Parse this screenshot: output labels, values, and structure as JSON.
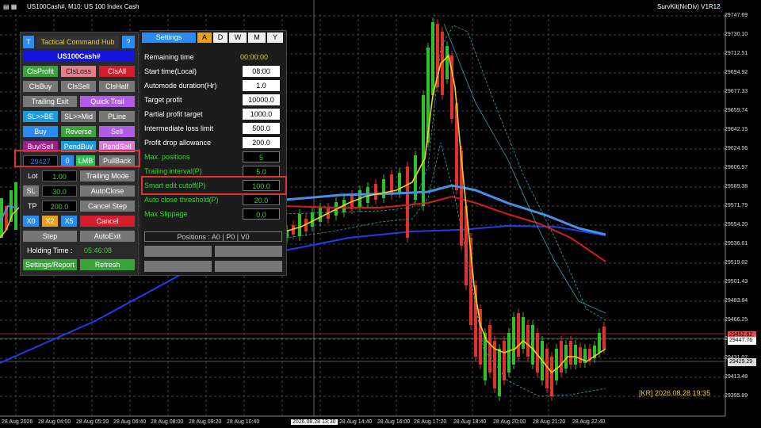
{
  "header": {
    "symbol_text": "US100Cash#, M10:  US 100 Index Cash",
    "indicator_text": "SurvKit(NoDiv) V1R12"
  },
  "price_axis": [
    "29747.69",
    "29730.10",
    "29712.51",
    "29694.92",
    "29677.33",
    "29659.74",
    "29642.15",
    "29624.56",
    "29606.97",
    "29589.38",
    "29571.79",
    "29554.20",
    "29536.61",
    "29519.02",
    "29501.43",
    "29483.84",
    "29466.25",
    "29448.66",
    "29431.07",
    "29413.48",
    "29395.89"
  ],
  "price_tags": [
    {
      "text": "29452.62",
      "color": "#e05050"
    },
    {
      "text": "29447.76",
      "color": "#ffffff"
    },
    {
      "text": "29429.29",
      "color": "#dddddd"
    }
  ],
  "time_axis": [
    "28 Aug 2026",
    "28 Aug 04:00",
    "28 Aug 05:20",
    "28 Aug 06:40",
    "28 Aug 08:00",
    "28 Aug 09:20",
    "28 Aug 10:40",
    "2026.08.28 13:30",
    "28 Aug 14:40",
    "28 Aug 16:00",
    "28 Aug 17:20",
    "28 Aug 18:40",
    "28 Aug 20:00",
    "28 Aug 21:20",
    "28 Aug 22:40"
  ],
  "kr_time": "[KR]  2026.08.28  19:35",
  "hub": {
    "t_btn": "T",
    "title": "Tactical Command Hub",
    "help": "?",
    "symbol": "US100Cash#",
    "row1": [
      "ClsProfit",
      "ClsLoss",
      "ClsAll"
    ],
    "row2": [
      "ClsBuy",
      "ClsSell",
      "ClsHalf"
    ],
    "trailing_exit": "Trailing Exit",
    "quick_trail": "Quick Trail",
    "row4": [
      "SL>>BE",
      "SL>>Mid",
      "PLine"
    ],
    "row5": [
      "Buy",
      "Reverse",
      "Sell"
    ],
    "row6": [
      "Buy/Sell",
      "PendBuy",
      "PendSell"
    ],
    "price_input": "29427",
    "zero": "0",
    "lmb": "LMB",
    "pullback": "PullBack",
    "lot_label": "Lot",
    "lot_value": "1.00",
    "trailing_mode": "Trailing Mode",
    "sl_label": "SL",
    "sl_value": "30.0",
    "autoclose": "AutoClose",
    "tp_label": "TP",
    "tp_value": "200.0",
    "cancel_step": "Cancel Step",
    "x0": "X0",
    "x2": "X2",
    "x5": "X5",
    "cancel": "Cancel",
    "step": "Step",
    "autoexit": "AutoExit",
    "holding_label": "Holding Time :",
    "holding_value": "05:46:08",
    "settings_report": "Settings/Report",
    "refresh": "Refresh"
  },
  "settings": {
    "tabs": [
      "Settings",
      "A",
      "D",
      "W",
      "M",
      "Y"
    ],
    "remaining_label": "Remaining time",
    "remaining_value": "00:00:00",
    "rows": [
      {
        "label": "Start time(Local)",
        "value": "08:00",
        "green": false
      },
      {
        "label": "Automode duration(Hr)",
        "value": "1.0",
        "green": false
      },
      {
        "label": "Target profit",
        "value": "10000.0",
        "green": false
      },
      {
        "label": "Partial profit target",
        "value": "1000.0",
        "green": false
      },
      {
        "label": "Intermediate loss limit",
        "value": "500.0",
        "green": false
      },
      {
        "label": "Profit drop allowance",
        "value": "200.0",
        "green": false
      },
      {
        "label": "Max. positions",
        "value": "5",
        "green": true
      },
      {
        "label": "Trailing interval(P)",
        "value": "5.0",
        "green": true
      },
      {
        "label": "Smart edit cutoff(P)",
        "value": "100.0",
        "green": true
      },
      {
        "label": "Auto close threshold(P)",
        "value": "20.0",
        "green": true
      },
      {
        "label": "Max Slippage",
        "value": "0.0",
        "green": true
      }
    ],
    "positions": "Positions : A0 | P0 | V0"
  }
}
